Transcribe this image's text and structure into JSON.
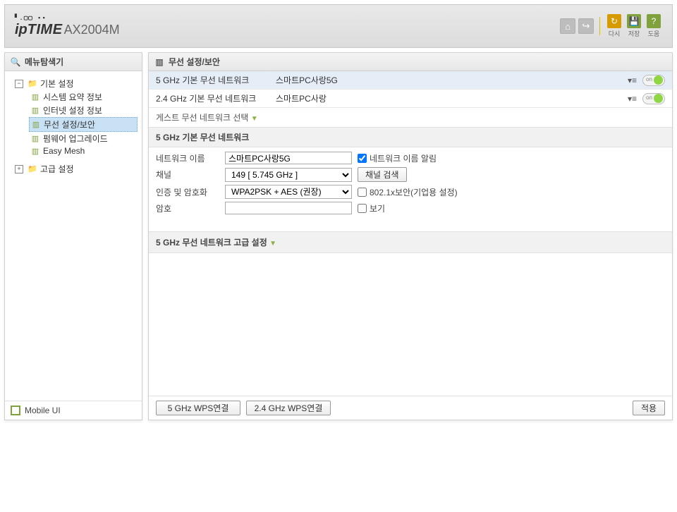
{
  "header": {
    "logo_dots": "▘.▢▢ ▪▪",
    "logo_ip": "ip",
    "logo_time": "TIME",
    "model": "AX2004M",
    "home_icon": "⌂",
    "logout_icon": "↪",
    "refresh_label": "다시",
    "refresh_icon": "↻",
    "save_label": "저장",
    "save_icon": "💾",
    "help_label": "도움",
    "help_icon": "?"
  },
  "sidebar": {
    "title": "메뉴탐색기",
    "search_icon": "🔍",
    "basic_group": "기본 설정",
    "items": [
      "시스템 요약 정보",
      "인터넷 설정 정보",
      "무선 설정/보안",
      "펌웨어 업그레이드",
      "Easy Mesh"
    ],
    "advanced_group": "고급 설정",
    "mobile_ui": "Mobile UI"
  },
  "main": {
    "title": "무선 설정/보안",
    "net5_name": "5 GHz 기본 무선 네트워크",
    "net5_ssid": "스마트PC사랑5G",
    "net24_name": "2.4 GHz 기본 무선 네트워크",
    "net24_ssid": "스마트PC사랑",
    "toggle_on": "on",
    "guest_row": "게스트 무선 네트워크 선택",
    "section_5g": "5 GHz 기본 무선 네트워크",
    "form": {
      "ssid_label": "네트워크 이름",
      "ssid_value": "스마트PC사랑5G",
      "broadcast_label": "네트워크 이름 알림",
      "channel_label": "채널",
      "channel_value": "149 [ 5.745 GHz ]",
      "channel_scan": "채널 검색",
      "auth_label": "인증 및 암호화",
      "auth_value": "WPA2PSK + AES (권장)",
      "dot1x_label": "802.1x보안(기업용 설정)",
      "pass_label": "암호",
      "pass_value": "",
      "show_label": "보기"
    },
    "adv_section": "5 GHz 무선 네트워크 고급 설정",
    "footer": {
      "wps5": "5 GHz WPS연결",
      "wps24": "2.4 GHz WPS연결",
      "apply": "적용"
    }
  }
}
